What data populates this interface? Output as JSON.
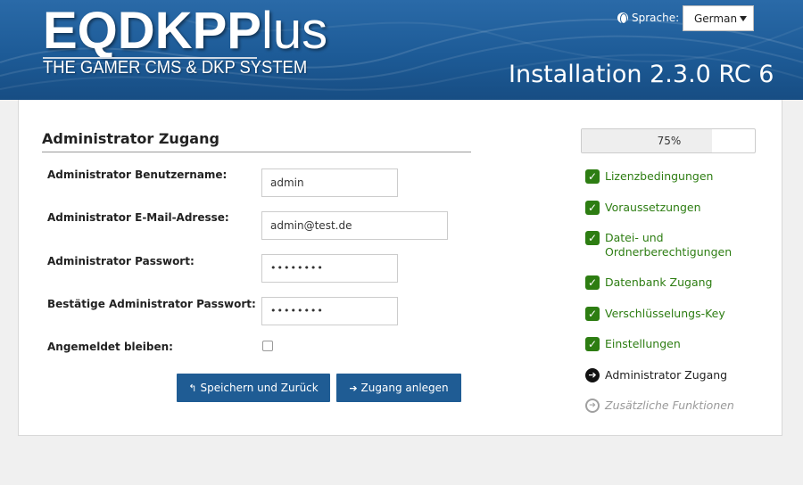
{
  "header": {
    "logo_main_bold": "EQDKP",
    "logo_main_thin": "lus",
    "logo_main_p": "P",
    "logo_sub": "THE GAMER CMS & DKP SYSTEM",
    "language_label": "Sprache:",
    "language_value": "German",
    "install_title": "Installation 2.3.0 RC 6"
  },
  "form": {
    "section_title": "Administrator Zugang",
    "fields": [
      {
        "label": "Administrator Benutzername:",
        "value": "admin"
      },
      {
        "label": "Administrator E-Mail-Adresse:",
        "value": "admin@test.de"
      },
      {
        "label": "Administrator Passwort:",
        "value": "••••••••"
      },
      {
        "label": "Bestätige Administrator Passwort:",
        "value": "••••••••"
      }
    ],
    "remember_label": "Angemeldet bleiben:",
    "remember_checked": false,
    "back_button": "Speichern und Zurück",
    "create_button": "Zugang anlegen"
  },
  "progress": {
    "percent": 75,
    "label": "75%"
  },
  "steps": [
    {
      "label": "Lizenzbedingungen",
      "state": "done"
    },
    {
      "label": "Voraussetzungen",
      "state": "done"
    },
    {
      "label": "Datei- und Ordnerberechtigungen",
      "state": "done"
    },
    {
      "label": "Datenbank Zugang",
      "state": "done"
    },
    {
      "label": "Verschlüsselungs-Key",
      "state": "done"
    },
    {
      "label": "Einstellungen",
      "state": "done"
    },
    {
      "label": "Administrator Zugang",
      "state": "current"
    },
    {
      "label": "Zusätzliche Funktionen",
      "state": "pending"
    }
  ],
  "colors": {
    "header_blue": "#1d5b97",
    "button_blue": "#1f5c94",
    "done_green": "#2d7d12"
  }
}
